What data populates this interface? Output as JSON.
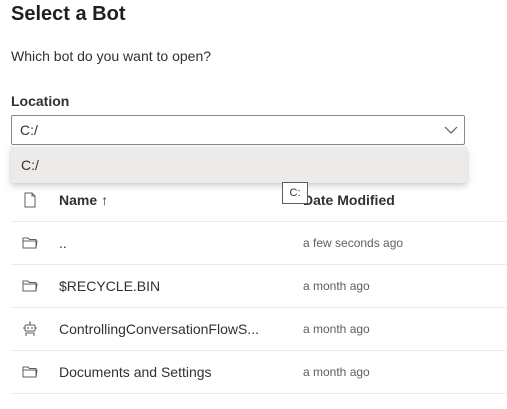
{
  "dialog": {
    "title": "Select a Bot",
    "subtitle": "Which bot do you want to open?"
  },
  "location": {
    "label": "Location",
    "selected": "C:/",
    "options": [
      "C:/"
    ],
    "tooltip": "C:"
  },
  "table": {
    "columns": {
      "name": "Name",
      "name_sort_indicator": "↑",
      "date": "Date Modified"
    },
    "rows": [
      {
        "icon": "folder-icon",
        "name": "..",
        "date": "a few seconds ago"
      },
      {
        "icon": "folder-icon",
        "name": "$RECYCLE.BIN",
        "date": "a month ago"
      },
      {
        "icon": "bot-icon",
        "name": "ControllingConversationFlowS...",
        "date": "a month ago"
      },
      {
        "icon": "folder-icon",
        "name": "Documents and Settings",
        "date": "a month ago"
      }
    ]
  }
}
